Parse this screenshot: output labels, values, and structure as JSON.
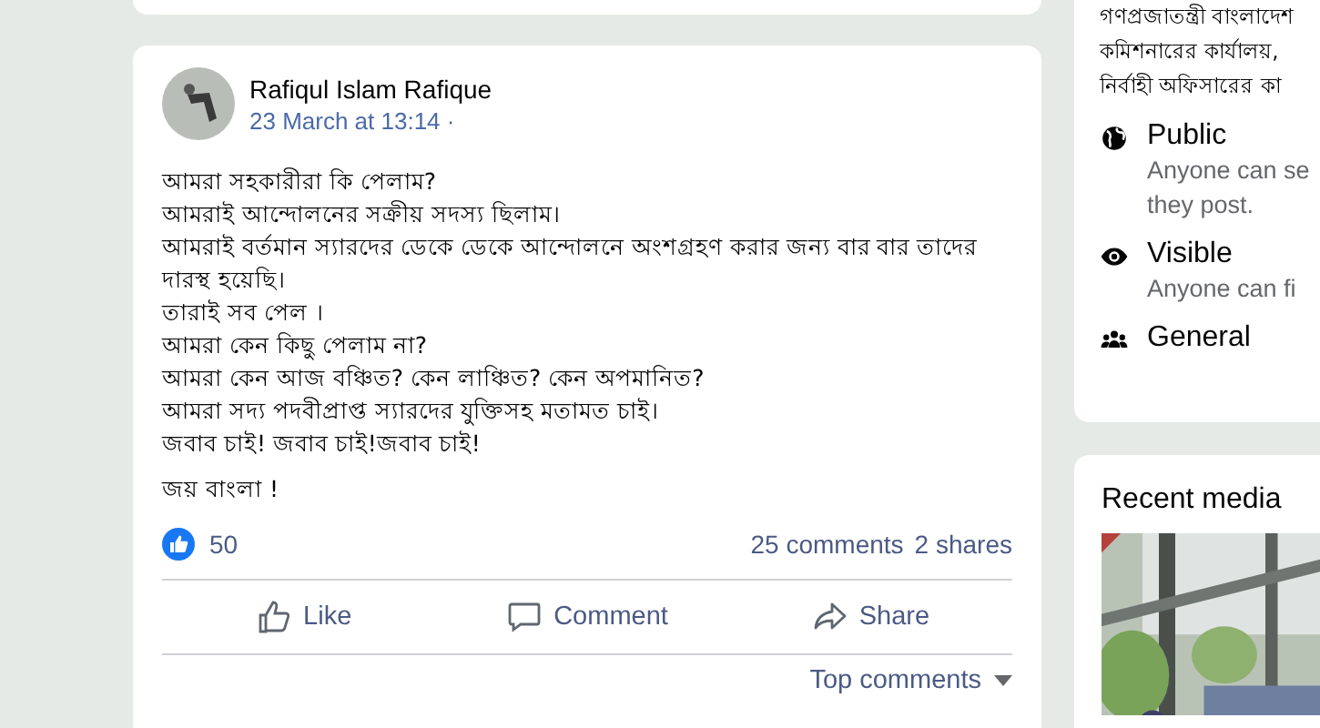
{
  "post": {
    "author": "Rafiqul Islam Rafique",
    "time": "23 March at 13:14 ·",
    "paragraphs": [
      [
        "আমরা সহকারীরা কি পেলাম?",
        "আমরাই আন্দোলনের সক্রীয় সদস্য ছিলাম।",
        "আমরাই বর্তমান স্যারদের ডেকে ডেকে আন্দোলনে অংশগ্রহণ করার জন্য বার বার তাদের দারস্থ হয়েছি।",
        "তারাই সব পেল ।",
        "আমরা  কেন কিছু পেলাম না?",
        "আমরা কেন আজ বঞ্চিত? কেন লাঞ্চিত? কেন অপমানিত?",
        "আমরা সদ্য পদবীপ্রাপ্ত স্যারদের যুক্তিসহ মতামত চাই।",
        "জবাব চাই! জবাব চাই!জবাব চাই!"
      ],
      [
        "জয় বাংলা !"
      ]
    ],
    "reactions": "50",
    "comments": "25 comments",
    "shares": "2 shares",
    "actions": [
      {
        "kind": "like",
        "label": "Like"
      },
      {
        "kind": "comment",
        "label": "Comment"
      },
      {
        "kind": "share",
        "label": "Share"
      }
    ],
    "sort": "Top comments"
  },
  "about": {
    "description": [
      "গণপ্রজাতন্ত্রী বাংলাদেশ",
      "কমিশনারের কার্যালয়,",
      "নির্বাহী অফিসারের কা"
    ],
    "items": [
      {
        "kind": "public",
        "title": "Public",
        "text": "Anyone can se they post."
      },
      {
        "kind": "visible",
        "title": "Visible",
        "text": "Anyone can fi"
      },
      {
        "kind": "general",
        "title": "General"
      }
    ]
  },
  "recent_media": {
    "title": "Recent media"
  }
}
